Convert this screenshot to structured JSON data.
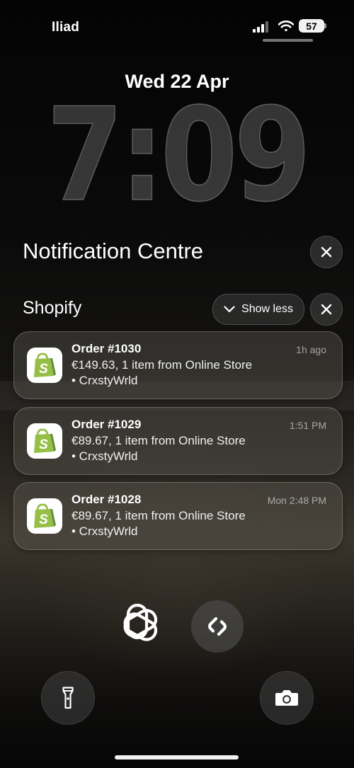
{
  "status_bar": {
    "carrier": "Iliad",
    "battery": "57"
  },
  "lock_screen": {
    "date": "Wed 22 Apr",
    "time": "7:09"
  },
  "notification_centre": {
    "title": "Notification Centre"
  },
  "group": {
    "app_name": "Shopify",
    "show_less_label": "Show less"
  },
  "notifications": [
    {
      "title": "Order #1030",
      "line1": "€149.63, 1 item from Online Store",
      "line2": "• CrxstyWrld",
      "time": "1h ago"
    },
    {
      "title": "Order #1029",
      "line1": "€89.67, 1 item from Online Store",
      "line2": "• CrxstyWrld",
      "time": "1:51 PM"
    },
    {
      "title": "Order #1028",
      "line1": "€89.67, 1 item from Online Store",
      "line2": "• CrxstyWrld",
      "time": "Mon 2:48 PM"
    }
  ],
  "icons": {
    "app_icon": "shopify-bag",
    "shortcut_left": "chatgpt-logo",
    "shortcut_right": "shazam-logo",
    "bottom_left": "flashlight",
    "bottom_right": "camera"
  },
  "colors": {
    "shopify_green": "#95bf47",
    "shopify_dark_green": "#5e8e3e"
  }
}
